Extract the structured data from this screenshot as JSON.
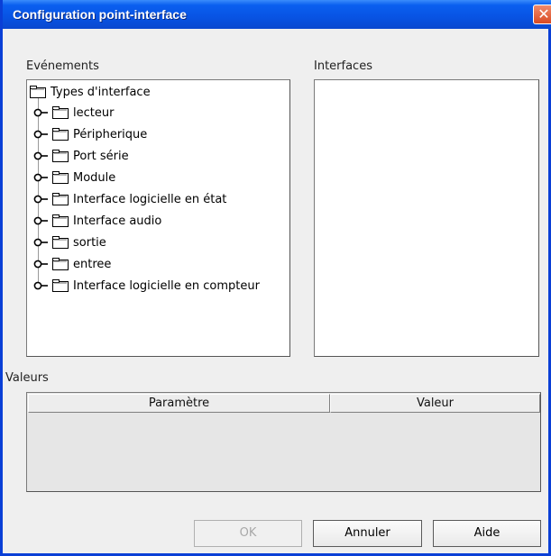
{
  "dialog": {
    "title": "Configuration point-interface",
    "close_symbol": "✕"
  },
  "events": {
    "label": "Evénements",
    "root": "Types d'interface",
    "items": [
      "lecteur",
      "Péripherique",
      "Port série",
      "Module",
      "Interface logicielle en état",
      "Interface audio",
      "sortie",
      "entree",
      "Interface logicielle en compteur"
    ]
  },
  "interfaces": {
    "label": "Interfaces"
  },
  "values": {
    "label": "Valeurs",
    "columns": [
      "Paramètre",
      "Valeur"
    ]
  },
  "buttons": {
    "ok": "OK",
    "cancel": "Annuler",
    "help": "Aide"
  },
  "colors": {
    "titlebar": "#0a5ff0",
    "close": "#d94a23",
    "frame": "#0a3fd6"
  }
}
